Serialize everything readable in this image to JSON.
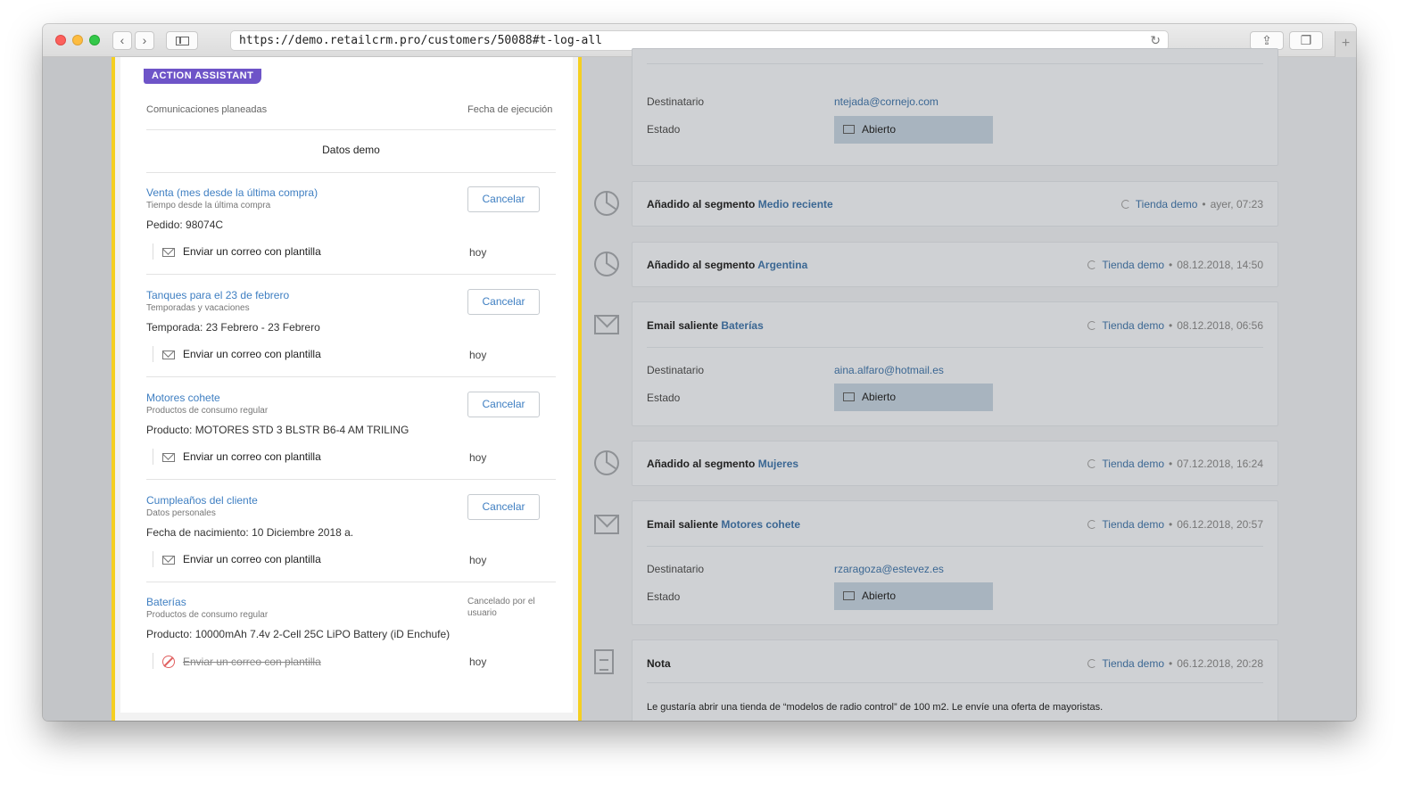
{
  "browser": {
    "url": "https://demo.retailcrm.pro/customers/50088#t-log-all",
    "back_glyph": "‹",
    "forward_glyph": "›",
    "new_tab_glyph": "+"
  },
  "assistant": {
    "badge": "ACTION ASSISTANT",
    "col_planned": "Comunicaciones planeadas",
    "col_date": "Fecha de ejecución",
    "demo_label": "Datos demo",
    "items": [
      {
        "title": "Venta (mes desde la última compra)",
        "subtitle": "Tiempo desde la última compra",
        "detail": "Pedido: 98074C",
        "button": "Cancelar",
        "action": "Enviar un correo con plantilla",
        "when": "hoy"
      },
      {
        "title": "Tanques para el 23 de febrero",
        "subtitle": "Temporadas y vacaciones",
        "detail": "Temporada: 23 Febrero - 23 Febrero",
        "button": "Cancelar",
        "action": "Enviar un correo con plantilla",
        "when": "hoy"
      },
      {
        "title": "Motores cohete",
        "subtitle": "Productos de consumo regular",
        "detail": "Producto: MOTORES STD 3 BLSTR B6-4 AM TRILING",
        "button": "Cancelar",
        "action": "Enviar un correo con plantilla",
        "when": "hoy"
      },
      {
        "title": "Cumpleaños del cliente",
        "subtitle": "Datos personales",
        "detail": "Fecha de nacimiento: 10 Diciembre 2018 a.",
        "button": "Cancelar",
        "action": "Enviar un correo con plantilla",
        "when": "hoy"
      },
      {
        "title": "Baterías",
        "subtitle": "Productos de consumo regular",
        "detail": "Producto: 10000mAh 7.4v 2-Cell 25C LiPO Battery (iD Enchufe)",
        "status": "Cancelado por el usuario",
        "action": "Enviar un correo con plantilla",
        "when": "hoy"
      }
    ]
  },
  "timeline": {
    "labels": {
      "recipient": "Destinatario",
      "state": "Estado"
    },
    "top": {
      "recipient": "ntejada@cornejo.com",
      "state": "Abierto"
    },
    "events": [
      {
        "prefix": "Añadido al segmento",
        "name": "Medio reciente",
        "store": "Tienda demo",
        "date": "ayer, 07:23"
      },
      {
        "prefix": "Añadido al segmento",
        "name": "Argentina",
        "store": "Tienda demo",
        "date": "08.12.2018, 14:50"
      },
      {
        "prefix": "Email saliente",
        "name": "Baterías",
        "store": "Tienda demo",
        "date": "08.12.2018, 06:56",
        "recipient": "aina.alfaro@hotmail.es",
        "state": "Abierto"
      },
      {
        "prefix": "Añadido al segmento",
        "name": "Mujeres",
        "store": "Tienda demo",
        "date": "07.12.2018, 16:24"
      },
      {
        "prefix": "Email saliente",
        "name": "Motores cohete",
        "store": "Tienda demo",
        "date": "06.12.2018, 20:57",
        "recipient": "rzaragoza@estevez.es",
        "state": "Abierto"
      },
      {
        "prefix": "Nota",
        "store": "Tienda demo",
        "date": "06.12.2018, 20:28",
        "note": "Le gustaría abrir una tienda de “modelos de radio control” de 100 m2. Le envíe una oferta de mayoristas."
      }
    ]
  },
  "colors": {
    "accent_purple": "#6e54c8",
    "highlight_yellow": "#f5cf21",
    "link_blue": "#3f7fc2",
    "status_fill": "#a8b4bf"
  }
}
